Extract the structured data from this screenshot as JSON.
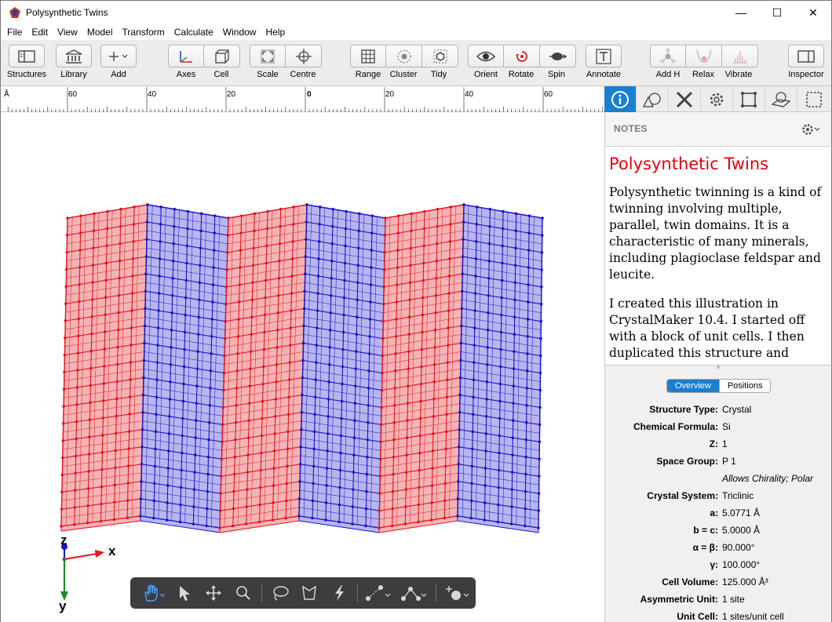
{
  "window": {
    "title": "Polysynthetic Twins",
    "controls": {
      "minimize": "—",
      "maximize": "☐",
      "close": "✕"
    }
  },
  "menu": [
    "File",
    "Edit",
    "View",
    "Model",
    "Transform",
    "Calculate",
    "Window",
    "Help"
  ],
  "toolbar": {
    "structures": "Structures",
    "library": "Library",
    "add": "Add",
    "axes": "Axes",
    "cell": "Cell",
    "scale": "Scale",
    "centre": "Centre",
    "range": "Range",
    "cluster": "Cluster",
    "tidy": "Tidy",
    "orient": "Orient",
    "rotate": "Rotate",
    "spin": "Spin",
    "annotate": "Annotate",
    "add_h": "Add H",
    "relax": "Relax",
    "vibrate": "Vibrate",
    "inspector": "Inspector"
  },
  "ruler": {
    "unit": "Å",
    "labels": [
      "60",
      "40",
      "20",
      "0",
      "20",
      "40",
      "60"
    ]
  },
  "axes": {
    "x": "x",
    "y": "y",
    "z": "z"
  },
  "colors": {
    "twin_a": "#e8141c",
    "twin_b": "#1a14c8",
    "accent": "#1a7fd0",
    "notes_title": "#e0000b"
  },
  "inspector": {
    "notes_label": "NOTES",
    "notes_title": "Polysynthetic Twins",
    "paragraphs": [
      "Polysynthetic twinning is a kind of twinning involving multiple, parallel, twin domains. It is a characteristic of many minerals, including plagioclase feldspar and leucite.",
      "I created this illustration in CrystalMaker 10.4. I started off with a block of unit cells. I then duplicated this structure and"
    ],
    "tabs": [
      "Overview",
      "Positions"
    ],
    "properties": [
      {
        "key": "Structure Type:",
        "value": "Crystal"
      },
      {
        "key": "Chemical Formula:",
        "value": "Si"
      },
      {
        "key": "Z:",
        "value": "1"
      },
      {
        "key": "Space Group:",
        "value": "P 1"
      },
      {
        "key": "",
        "value": "Allows Chirality; Polar"
      },
      {
        "key": "Crystal System:",
        "value": "Triclinic"
      },
      {
        "key": "a:",
        "value": "5.0771 Å"
      },
      {
        "key": "b = c:",
        "value": "5.0000 Å"
      },
      {
        "key": "α = β:",
        "value": "90.000°"
      },
      {
        "key": "γ:",
        "value": "100.000°"
      },
      {
        "key": "Cell Volume:",
        "value": "125.000 Å³"
      },
      {
        "key": "Asymmetric Unit:",
        "value": "1 site"
      },
      {
        "key": "Unit Cell:",
        "value": "1 sites/unit cell"
      }
    ]
  }
}
